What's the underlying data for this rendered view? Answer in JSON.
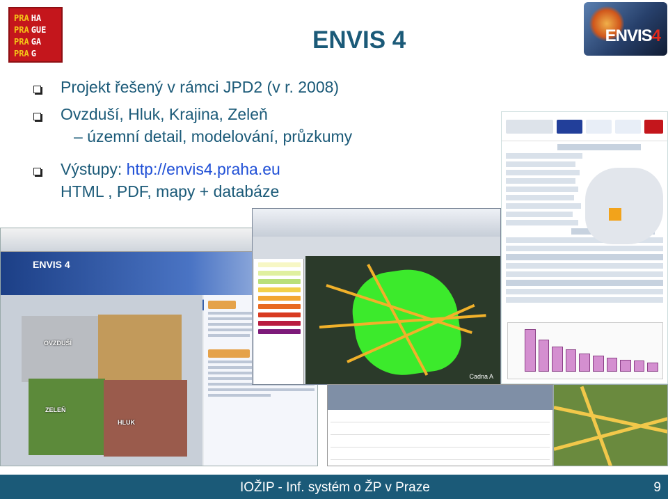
{
  "logo": {
    "lines": [
      [
        "PRA",
        "HA"
      ],
      [
        "PRA",
        "GUE"
      ],
      [
        "PRA",
        "GA"
      ],
      [
        "PRA",
        "G"
      ]
    ],
    "colors": {
      "bg": "#c4161c",
      "yellow": "#f5c518"
    }
  },
  "title": "ENVIS 4",
  "envis_logo_text": "ENVIS",
  "envis_logo_num": "4",
  "bullets": {
    "b1": "Projekt řešený v rámci JPD2 (v r. 2008)",
    "b2": "Ovzduší, Hluk, Krajina, Zeleň",
    "b2_sub": "– územní detail, modelování, průzkumy",
    "b3_prefix": "Výstupy: ",
    "b3_url": "http://envis4.praha.eu",
    "b3_sub": "HTML , PDF, mapy + databáze"
  },
  "footer": {
    "text": "IOŽIP - Inf. systém o ŽP v Praze",
    "page": "9"
  },
  "colors": {
    "title": "#1b5a78",
    "link": "#1f4fd6",
    "footer_bg": "#1b5a78"
  }
}
